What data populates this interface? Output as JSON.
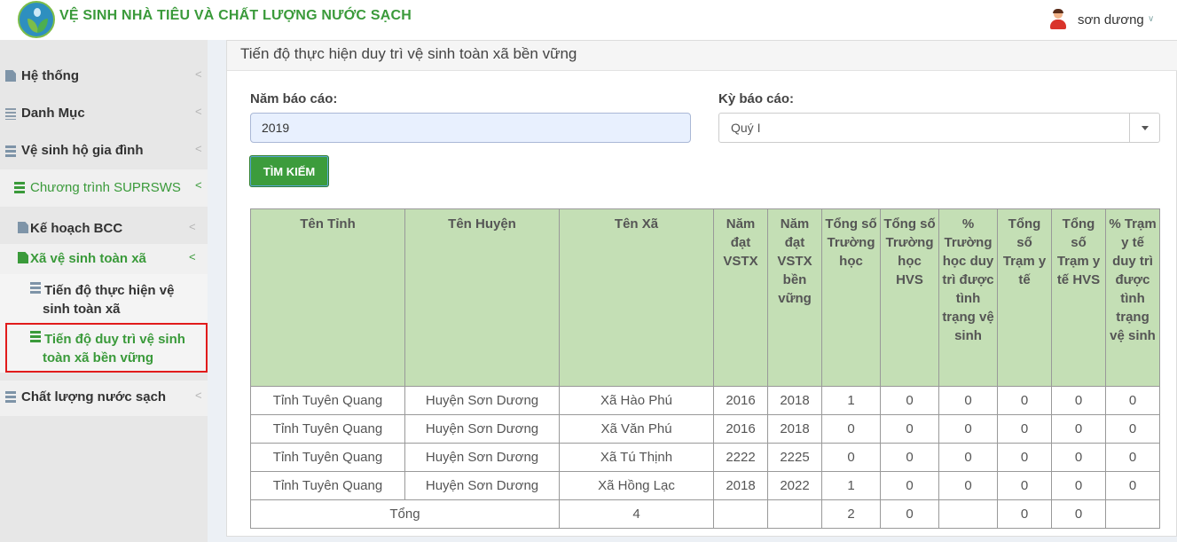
{
  "header": {
    "app_title": "VỆ SINH NHÀ TIÊU VÀ CHẤT LƯỢNG NƯỚC SẠCH",
    "user_name": "sơn dương",
    "logo_icon": "logo-icon",
    "avatar_icon": "user-avatar-icon",
    "caret_icon": "chevron-down-icon"
  },
  "sidebar": {
    "items": [
      {
        "label": "Hệ thống",
        "icon": "document-icon"
      },
      {
        "label": "Danh Mục",
        "icon": "list-icon"
      },
      {
        "label": "Vệ sinh hộ gia đình",
        "icon": "server-icon"
      },
      {
        "label": "Chương trình SUPRSWS",
        "icon": "server-icon"
      },
      {
        "label": "Kế hoạch BCC",
        "icon": "document-icon"
      },
      {
        "label": "Xã vệ sinh toàn xã",
        "icon": "document-icon"
      },
      {
        "label": "Tiến độ thực hiện vệ sinh toàn xã",
        "icon": "server-icon"
      },
      {
        "label": "Tiến độ duy trì vệ sinh toàn xã bền vững",
        "icon": "server-icon"
      },
      {
        "label": "Chất lượng nước sạch",
        "icon": "server-icon"
      }
    ]
  },
  "main": {
    "title": "Tiến độ thực hiện duy trì vệ sinh toàn xã bền vững",
    "year_label": "Năm báo cáo:",
    "year_value": "2019",
    "period_label": "Kỳ báo cáo:",
    "period_value": "Quý I",
    "search_button": "TÌM KIẾM"
  },
  "table": {
    "headers": [
      "Tên Tỉnh",
      "Tên Huyện",
      "Tên Xã",
      "Năm đạt VSTX",
      "Năm đạt VSTX bền vững",
      "Tổng số Trường học",
      "Tổng số Trường học HVS",
      "% Trường học duy trì được tình trạng vệ sinh",
      "Tổng số Trạm y tế",
      "Tổng số Trạm y tế HVS",
      "% Trạm y tế duy trì được tình trạng vệ sinh"
    ],
    "rows": [
      [
        "Tỉnh Tuyên Quang",
        "Huyện Sơn Dương",
        "Xã Hào Phú",
        "2016",
        "2018",
        "1",
        "0",
        "0",
        "0",
        "0",
        "0"
      ],
      [
        "Tỉnh Tuyên Quang",
        "Huyện Sơn Dương",
        "Xã Văn Phú",
        "2016",
        "2018",
        "0",
        "0",
        "0",
        "0",
        "0",
        "0"
      ],
      [
        "Tỉnh Tuyên Quang",
        "Huyện Sơn Dương",
        "Xã Tú Thịnh",
        "2222",
        "2225",
        "0",
        "0",
        "0",
        "0",
        "0",
        "0"
      ],
      [
        "Tỉnh Tuyên Quang",
        "Huyện Sơn Dương",
        "Xã Hồng Lạc",
        "2018",
        "2022",
        "1",
        "0",
        "0",
        "0",
        "0",
        "0"
      ]
    ],
    "total": {
      "label": "Tổng",
      "xa_count": "4",
      "truong_hoc": "2",
      "truong_hoc_hvs": "0",
      "tram_y_te": "0",
      "tram_y_te_hvs": "0"
    }
  },
  "colors": {
    "brand_green": "#3a9a3a",
    "table_header_bg": "#c4dfb5",
    "active_border": "#e11b1b"
  }
}
